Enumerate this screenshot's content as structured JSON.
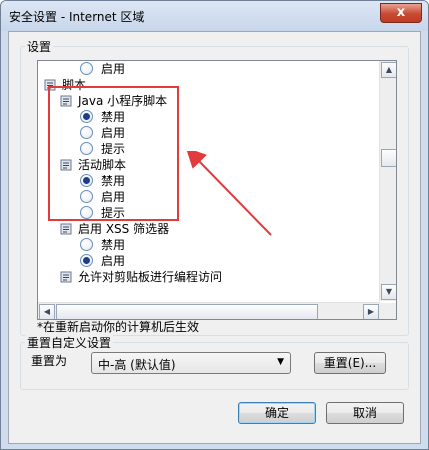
{
  "window": {
    "title": "安全设置 - Internet 区域",
    "close_symbol": "x"
  },
  "settings": {
    "group_label": "设置",
    "tree_rows": [
      {
        "kind": "radio",
        "label": "启用",
        "checked": false
      },
      {
        "kind": "category",
        "label": "脚本"
      },
      {
        "kind": "category",
        "label": "Java 小程序脚本"
      },
      {
        "kind": "radio",
        "label": "禁用",
        "checked": true
      },
      {
        "kind": "radio",
        "label": "启用",
        "checked": false
      },
      {
        "kind": "radio",
        "label": "提示",
        "checked": false
      },
      {
        "kind": "category",
        "label": "活动脚本"
      },
      {
        "kind": "radio",
        "label": "禁用",
        "checked": true
      },
      {
        "kind": "radio",
        "label": "启用",
        "checked": false
      },
      {
        "kind": "radio",
        "label": "提示",
        "checked": false
      },
      {
        "kind": "category",
        "label": "启用 XSS 筛选器"
      },
      {
        "kind": "radio",
        "label": "禁用",
        "checked": false
      },
      {
        "kind": "radio",
        "label": "启用",
        "checked": true
      },
      {
        "kind": "category",
        "label": "允许对剪贴板进行编程访问"
      }
    ],
    "note": "*在重新启动你的计算机后生效"
  },
  "reset": {
    "group_label": "重置自定义设置",
    "reset_to_label": "重置为",
    "selected_level": "中-高 (默认值)",
    "reset_button": "重置(E)..."
  },
  "footer": {
    "ok_button": "确定",
    "cancel_button": "取消"
  },
  "colors": {
    "highlight_box": "#e23b3b",
    "arrow": "#e23b3b"
  }
}
